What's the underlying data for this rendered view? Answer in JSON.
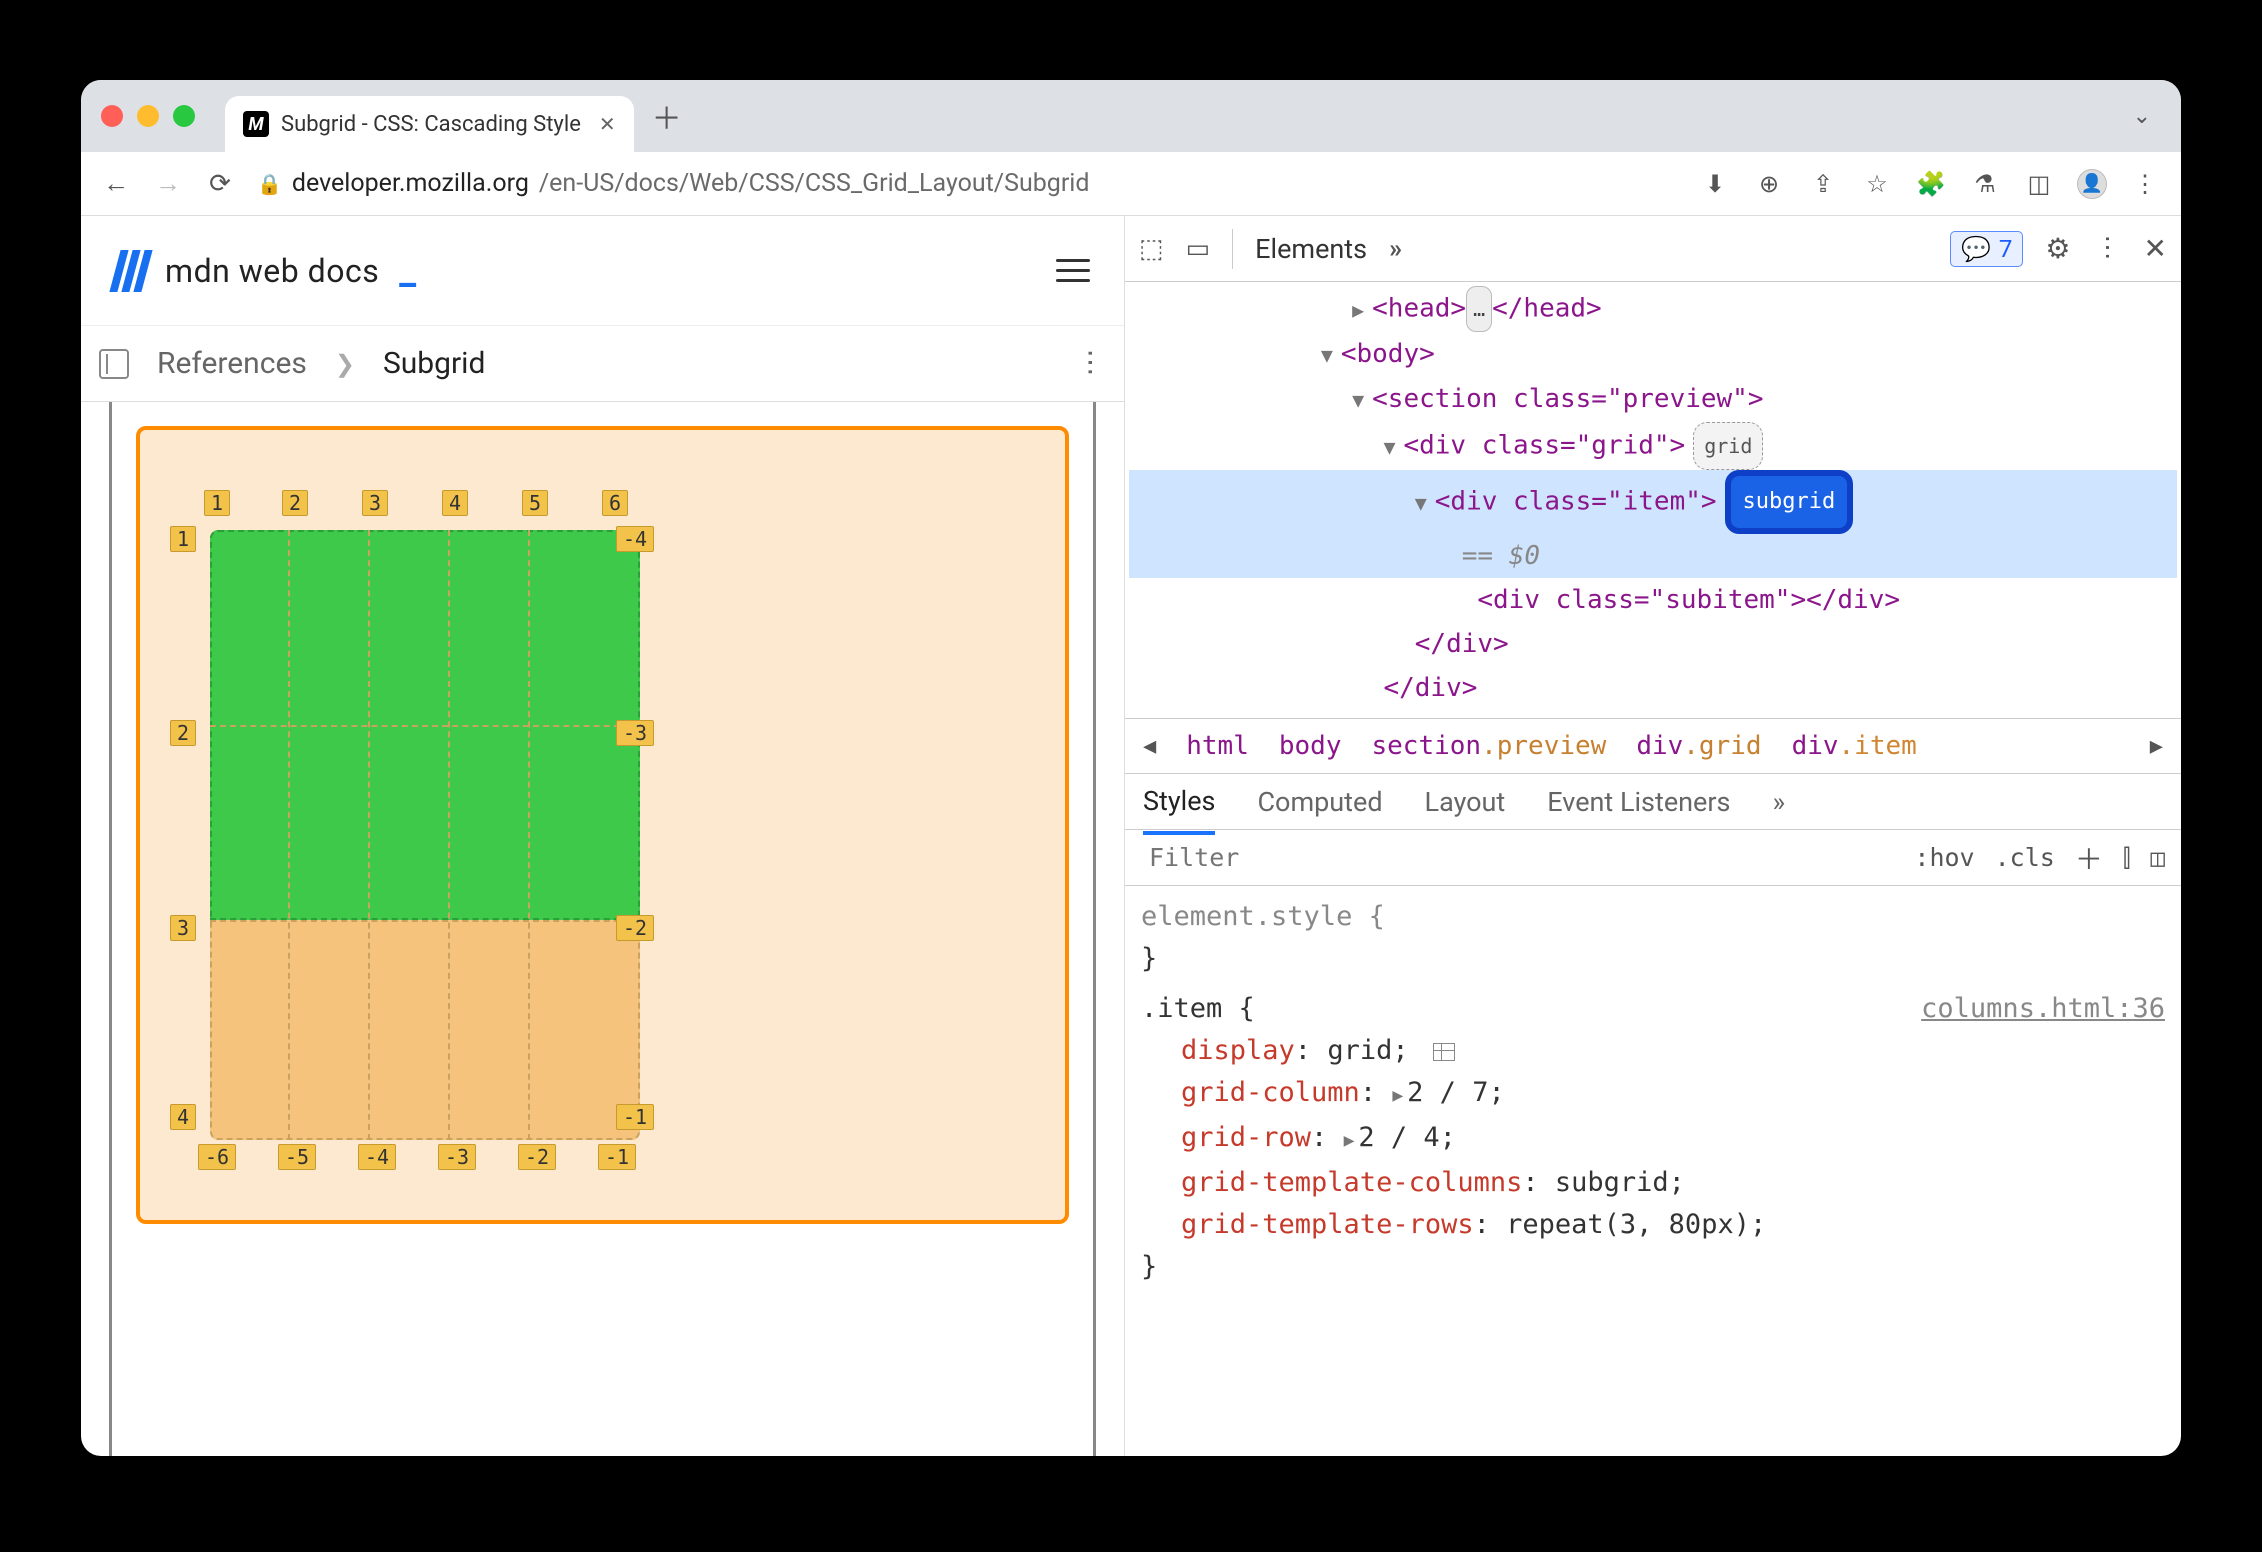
{
  "tab": {
    "title": "Subgrid - CSS: Cascading Style"
  },
  "url": {
    "host": "developer.mozilla.org",
    "path": "/en-US/docs/Web/CSS/CSS_Grid_Layout/Subgrid"
  },
  "mdn": {
    "name": "mdn web docs"
  },
  "crumb": {
    "root": "References",
    "current": "Subgrid"
  },
  "grid_labels": {
    "top": [
      "1",
      "2",
      "3",
      "4",
      "5",
      "6"
    ],
    "left": [
      "1",
      "2",
      "3",
      "4"
    ],
    "right": [
      "-4",
      "-3",
      "-2",
      "-1"
    ],
    "bottom": [
      "-6",
      "-5",
      "-4",
      "-3",
      "-2",
      "-1"
    ]
  },
  "devtools": {
    "tab": "Elements",
    "issues_count": "7",
    "dom": {
      "head_open": "<head>",
      "head_ell": "…",
      "head_close": "</head>",
      "body": "<body>",
      "section": "<section class=\"preview\">",
      "divgrid": "<div class=\"grid\">",
      "gridchip": "grid",
      "divitem": "<div class=\"item\">",
      "subgrid_badge": "subgrid",
      "eq0": "== $0",
      "subitem": "<div class=\"subitem\"></div>",
      "close_div1": "</div>",
      "close_div2": "</div>"
    },
    "path": {
      "html": "html",
      "body": "body",
      "section": "section",
      "section_cls": ".preview",
      "div1": "div",
      "div1_cls": ".grid",
      "div2": "div",
      "div2_cls": ".item"
    },
    "subtabs": {
      "styles": "Styles",
      "computed": "Computed",
      "layout": "Layout",
      "events": "Event Listeners"
    },
    "filter": {
      "placeholder": "Filter",
      "hov": ":hov",
      "cls": ".cls"
    },
    "style_block": {
      "elstyle": "element.style {",
      "close1": "}",
      "sel": ".item {",
      "src": "columns.html:36",
      "r1p": "display",
      "r1v": "grid;",
      "r2p": "grid-column",
      "r2v": "2 / 7;",
      "r3p": "grid-row",
      "r3v": "2 / 4;",
      "r4p": "grid-template-columns",
      "r4v": "subgrid;",
      "r5p": "grid-template-rows",
      "r5v": "repeat(3, 80px);",
      "close2": "}"
    }
  }
}
